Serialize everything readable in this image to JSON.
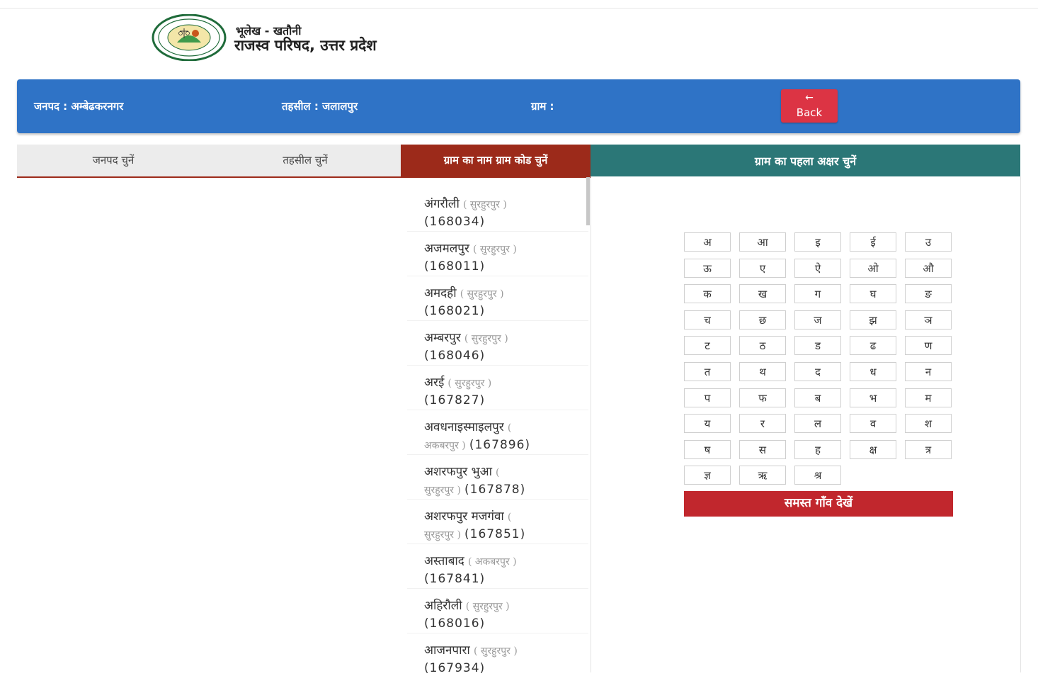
{
  "header": {
    "subtitle": "भूलेख - खतौनी",
    "title": "राजस्व परिषद, उत्तर प्रदेश"
  },
  "infobar": {
    "janpad": "जनपद : अम्बेढकरनगर",
    "tehsil": "तहसील : जलालपुर",
    "gram": "ग्राम :",
    "back_arrow": "←",
    "back_label": "Back"
  },
  "tabs": [
    {
      "label": "जनपद चुनें"
    },
    {
      "label": "तहसील चुनें"
    },
    {
      "label": "ग्राम का नाम ग्राम कोड चुनें"
    }
  ],
  "letters_panel": {
    "title": "ग्राम का पहला अक्षर चुनें",
    "letters": [
      "अ",
      "आ",
      "इ",
      "ई",
      "उ",
      "ऊ",
      "ए",
      "ऐ",
      "ओ",
      "औ",
      "क",
      "ख",
      "ग",
      "घ",
      "ङ",
      "च",
      "छ",
      "ज",
      "झ",
      "ञ",
      "ट",
      "ठ",
      "ड",
      "ढ",
      "ण",
      "त",
      "थ",
      "द",
      "ध",
      "न",
      "प",
      "फ",
      "ब",
      "भ",
      "म",
      "य",
      "र",
      "ल",
      "व",
      "श",
      "ष",
      "स",
      "ह",
      "क्ष",
      "त्र",
      "ज्ञ",
      "ऋ",
      "श्र"
    ],
    "all_villages": "समस्त गाँव देखें"
  },
  "villages": [
    {
      "l1_name": "अंगरौली",
      "l1_teh": "( सुरहुरपुर )",
      "l2_teh": "",
      "l2_code": "(168034)"
    },
    {
      "l1_name": "अजमलपुर",
      "l1_teh": "( सुरहुरपुर )",
      "l2_teh": "",
      "l2_code": "(168011)"
    },
    {
      "l1_name": "अमदही",
      "l1_teh": "( सुरहुरपुर )",
      "l2_teh": "",
      "l2_code": "(168021)"
    },
    {
      "l1_name": "अम्बरपुर",
      "l1_teh": "( सुरहुरपुर )",
      "l2_teh": "",
      "l2_code": "(168046)"
    },
    {
      "l1_name": "अरई",
      "l1_teh": "( सुरहुरपुर )",
      "l2_teh": "",
      "l2_code": "(167827)"
    },
    {
      "l1_name": "अवधनाइस्माइलपुर",
      "l1_teh": "(",
      "l2_teh": "अकबरपुर )",
      "l2_code": "(167896)"
    },
    {
      "l1_name": "अशरफपुर भुआ",
      "l1_teh": "(",
      "l2_teh": "सुरहुरपुर )",
      "l2_code": "(167878)"
    },
    {
      "l1_name": "अशरफपुर मजगंवा",
      "l1_teh": "(",
      "l2_teh": "सुरहुरपुर )",
      "l2_code": "(167851)"
    },
    {
      "l1_name": "अस्ताबाद",
      "l1_teh": "( अकबरपुर )",
      "l2_teh": "",
      "l2_code": "(167841)"
    },
    {
      "l1_name": "अहिरौली",
      "l1_teh": "( सुरहुरपुर )",
      "l2_teh": "",
      "l2_code": "(168016)"
    },
    {
      "l1_name": "आजनपारा",
      "l1_teh": "( सुरहुरपुर )",
      "l2_teh": "",
      "l2_code": "(167934)"
    }
  ]
}
